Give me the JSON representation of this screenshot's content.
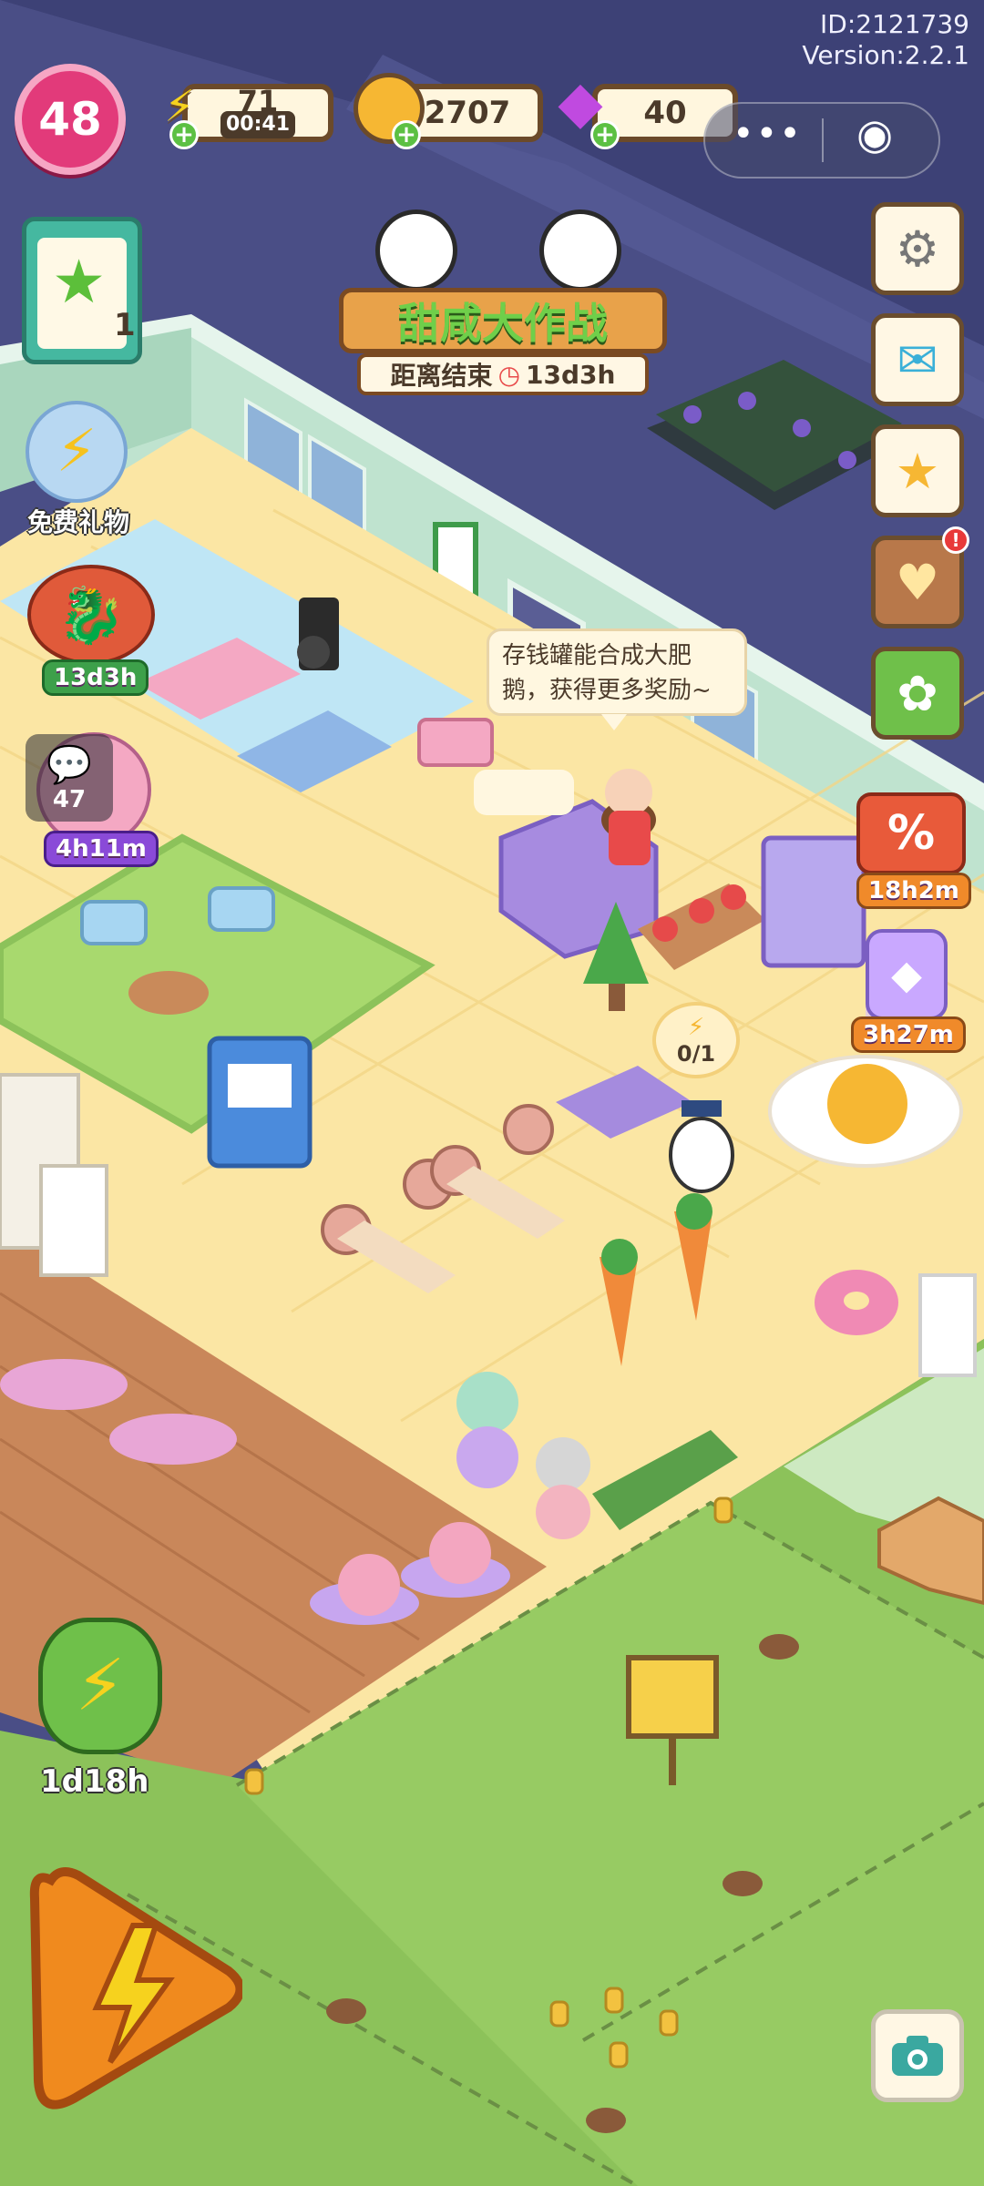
{
  "header": {
    "player_id": "ID:2121739",
    "version": "Version:2.2.1"
  },
  "player": {
    "level": "48"
  },
  "resources": {
    "energy": {
      "value": "71",
      "timer": "00:41",
      "icon": "lightning-icon"
    },
    "coins": {
      "value": "2707",
      "icon": "coin-icon"
    },
    "gems": {
      "value": "40",
      "icon": "gem-icon"
    }
  },
  "capsule": {
    "more": "•••",
    "close": "◉"
  },
  "event_banner": {
    "title": "甜咸大作战",
    "ends_label": "距离结束",
    "ends_time": "13d3h"
  },
  "tasks": {
    "count": "1",
    "icon": "clipboard-star-icon"
  },
  "left_events": {
    "free_gift": "免费礼物",
    "dragon_event_time": "13d3h",
    "chat_count": "47",
    "chat_time": "4h11m"
  },
  "right_menu": [
    {
      "name": "settings-button",
      "icon": "⚙"
    },
    {
      "name": "mail-button",
      "icon": "✉"
    },
    {
      "name": "medal-button",
      "icon": "★"
    },
    {
      "name": "collection-book-button",
      "icon": "♥"
    },
    {
      "name": "guide-book-button",
      "icon": "✿"
    }
  ],
  "right_events": {
    "sale_label": "%",
    "sale_time": "18h2m",
    "jar_time": "3h27m"
  },
  "speech_bubble": {
    "text_line1": "存钱罐能合成大肥",
    "text_line2": "鹅，获得更多奖励~"
  },
  "duck_task": {
    "progress": "0/1"
  },
  "bottom_left": {
    "boost_time": "1d18h"
  },
  "camera": {
    "icon": "camera-icon"
  },
  "colors": {
    "accent_pink": "#e23a7a",
    "wood_border": "#6b4a2a",
    "grass": "#8cc25a",
    "floor": "#fbe6a4"
  }
}
